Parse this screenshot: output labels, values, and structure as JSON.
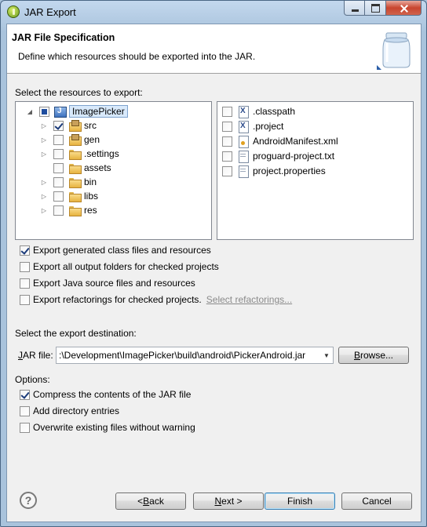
{
  "window": {
    "title": "JAR Export"
  },
  "banner": {
    "title": "JAR File Specification",
    "description": "Define which resources should be exported into the JAR."
  },
  "resources": {
    "label": "Select the resources to export:",
    "tree": [
      {
        "label": "ImagePicker",
        "icon": "project-icon",
        "state": "partial",
        "expander": "open",
        "level": 0
      },
      {
        "label": "src",
        "icon": "package-folder-icon",
        "state": "checked",
        "expander": "closed",
        "level": 1
      },
      {
        "label": "gen",
        "icon": "package-folder-icon",
        "state": "unchecked",
        "expander": "closed",
        "level": 1
      },
      {
        "label": ".settings",
        "icon": "folder-icon",
        "state": "unchecked",
        "expander": "closed",
        "level": 1
      },
      {
        "label": "assets",
        "icon": "folder-icon",
        "state": "unchecked",
        "expander": "none",
        "level": 1
      },
      {
        "label": "bin",
        "icon": "folder-icon",
        "state": "unchecked",
        "expander": "closed",
        "level": 1
      },
      {
        "label": "libs",
        "icon": "folder-icon",
        "state": "unchecked",
        "expander": "closed",
        "level": 1
      },
      {
        "label": "res",
        "icon": "folder-icon",
        "state": "unchecked",
        "expander": "closed",
        "level": 1
      }
    ],
    "files": [
      {
        "label": ".classpath",
        "icon": "xml-file-icon",
        "state": "unchecked"
      },
      {
        "label": ".project",
        "icon": "xml-file-icon",
        "state": "unchecked"
      },
      {
        "label": "AndroidManifest.xml",
        "icon": "manifest-file-icon",
        "state": "unchecked"
      },
      {
        "label": "proguard-project.txt",
        "icon": "text-file-icon",
        "state": "unchecked"
      },
      {
        "label": "project.properties",
        "icon": "text-file-icon",
        "state": "unchecked"
      }
    ]
  },
  "export_options": [
    {
      "label": "Export generated class files and resources",
      "checked": true
    },
    {
      "label": "Export all output folders for checked projects",
      "checked": false
    },
    {
      "label": "Export Java source files and resources",
      "checked": false
    },
    {
      "label": "Export refactorings for checked projects.",
      "checked": false,
      "link": "Select refactorings..."
    }
  ],
  "destination": {
    "label": "Select the export destination:",
    "jar_label": "JAR file:",
    "jar_value": ":\\Development\\ImagePicker\\build\\android\\PickerAndroid.jar",
    "browse": "Browse..."
  },
  "options": {
    "label": "Options:",
    "items": [
      {
        "label": "Compress the contents of the JAR file",
        "checked": true
      },
      {
        "label": "Add directory entries",
        "checked": false
      },
      {
        "label": "Overwrite existing files without warning",
        "checked": false
      }
    ]
  },
  "buttons": {
    "help": "?",
    "back": "< Back",
    "next": "Next >",
    "finish": "Finish",
    "cancel": "Cancel"
  }
}
